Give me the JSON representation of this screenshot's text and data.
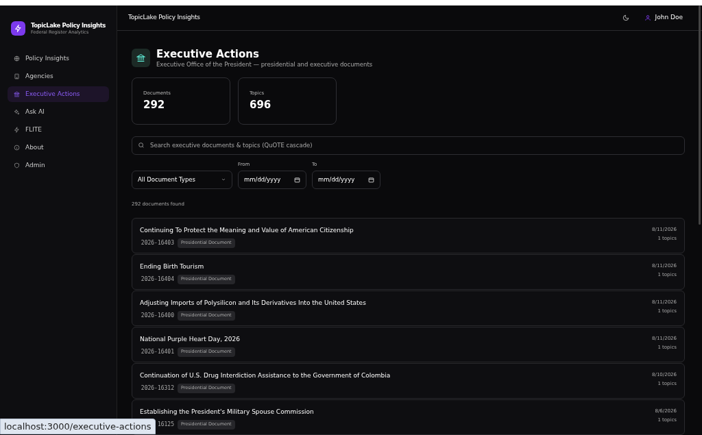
{
  "sidebar": {
    "app_name": "TopicLake Policy Insights",
    "app_subtitle": "Federal Register Analytics",
    "items": [
      {
        "label": "Policy Insights",
        "selected": false
      },
      {
        "label": "Agencies",
        "selected": false
      },
      {
        "label": "Executive Actions",
        "selected": true
      },
      {
        "label": "Ask AI",
        "selected": false
      },
      {
        "label": "FLITE",
        "selected": false
      },
      {
        "label": "About",
        "selected": false
      },
      {
        "label": "Admin",
        "selected": false
      }
    ]
  },
  "header": {
    "title": "TopicLake Policy Insights",
    "user": "John Doe"
  },
  "page": {
    "title": "Executive Actions",
    "subtitle": "Executive Office of the President — presidential and executive documents"
  },
  "stats": [
    {
      "label": "Documents",
      "value": "292"
    },
    {
      "label": "Topics",
      "value": "696"
    }
  ],
  "search": {
    "placeholder": "Search executive documents & topics (QuOTE cascade)"
  },
  "filters": {
    "document_type": "All Document Types",
    "from_label": "From",
    "from_placeholder": "mm/dd/yyyy",
    "to_label": "To",
    "to_placeholder": "mm/dd/yyyy"
  },
  "result_count": "292 documents found",
  "documents": [
    {
      "title": "Continuing To Protect the Meaning and Value of American Citizenship",
      "id": "2026-16403",
      "type": "Presidential Document",
      "date": "8/11/2026",
      "topics": "1 topics"
    },
    {
      "title": "Ending Birth Tourism",
      "id": "2026-16404",
      "type": "Presidential Document",
      "date": "8/11/2026",
      "topics": "1 topics"
    },
    {
      "title": "Adjusting Imports of Polysilicon and Its Derivatives Into the United States",
      "id": "2026-16400",
      "type": "Presidential Document",
      "date": "8/11/2026",
      "topics": "1 topics"
    },
    {
      "title": "National Purple Heart Day, 2026",
      "id": "2026-16401",
      "type": "Presidential Document",
      "date": "8/11/2026",
      "topics": "1 topics"
    },
    {
      "title": "Continuation of U.S. Drug Interdiction Assistance to the Government of Colombia",
      "id": "2026-16312",
      "type": "Presidential Document",
      "date": "8/10/2026",
      "topics": "1 topics"
    },
    {
      "title": "Establishing the President's Military Spouse Commission",
      "id": "16125",
      "type": "Presidential Document",
      "date": "8/6/2026",
      "topics": "1 topics"
    }
  ],
  "status_url": "localhost:3000/executive-actions"
}
